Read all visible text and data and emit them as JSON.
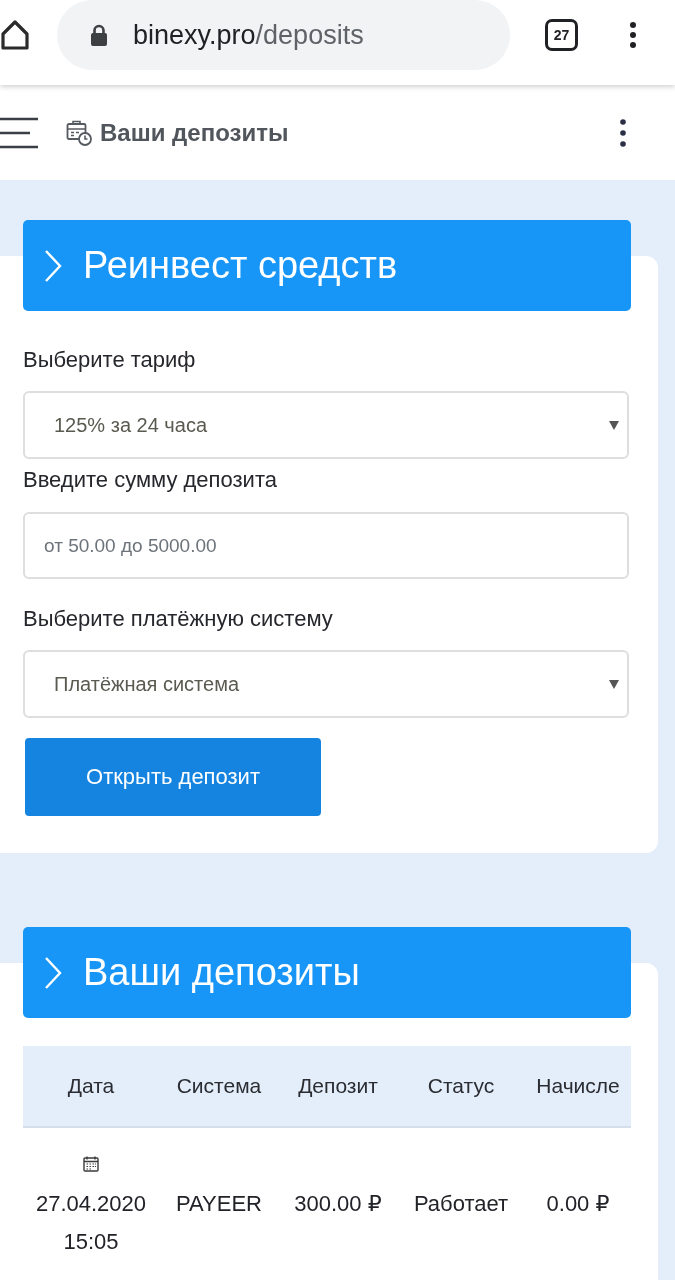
{
  "browser": {
    "url_host": "binexy.pro",
    "url_path": "/deposits",
    "tab_count": "27"
  },
  "app_bar": {
    "title": "Ваши депозиты"
  },
  "reinvest": {
    "title": "Реинвест средств",
    "fields": [
      {
        "kind": "select",
        "label": "Выберите тариф",
        "value": "125% за 24 часа"
      },
      {
        "kind": "input",
        "label": "Введите сумму депозита",
        "placeholder": "от 50.00 до 5000.00"
      },
      {
        "kind": "select",
        "label": "Выберите платёжную систему",
        "value": "Платёжная система"
      }
    ],
    "button": "Открыть депозит"
  },
  "deposits": {
    "title": "Ваши депозиты",
    "table": {
      "columns": [
        "Дата",
        "Система",
        "Депозит",
        "Статус",
        "Начисле"
      ],
      "rows": [
        {
          "cells": [
            "27.04.2020 15:05",
            "PAYEER",
            "300.00 ₽",
            "Работает",
            "0.00 ₽"
          ]
        }
      ]
    }
  }
}
